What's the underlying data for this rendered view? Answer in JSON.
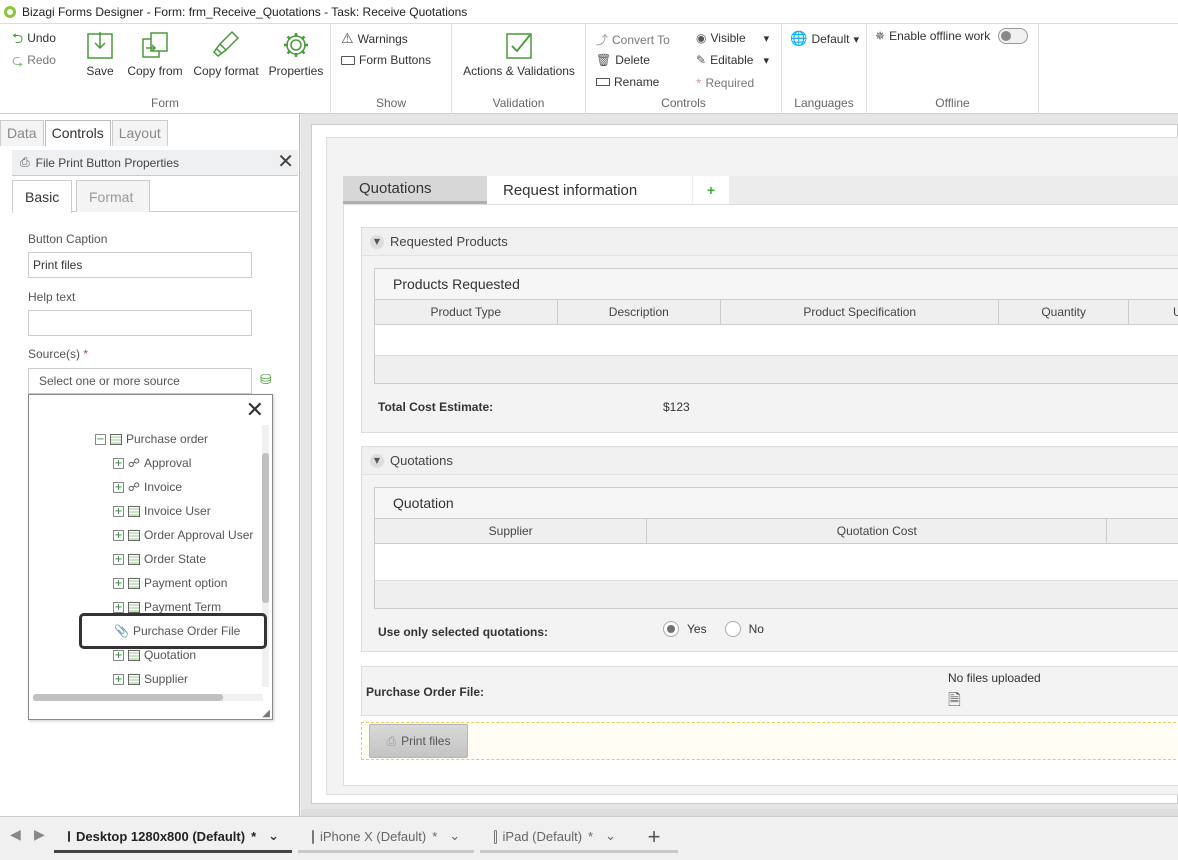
{
  "window": {
    "title": "Bizagi Forms Designer  -  Form: frm_Receive_Quotations - Task:  Receive Quotations"
  },
  "ribbon": {
    "form": {
      "label": "Form",
      "undo": "Undo",
      "redo": "Redo",
      "save": "Save",
      "copy_from": "Copy from",
      "copy_format": "Copy format",
      "properties": "Properties"
    },
    "show": {
      "label": "Show",
      "warnings": "Warnings",
      "form_buttons": "Form Buttons"
    },
    "validation": {
      "label": "Validation",
      "actions": "Actions & Validations"
    },
    "controls": {
      "label": "Controls",
      "convert_to": "Convert To",
      "delete": "Delete",
      "rename": "Rename",
      "visible": "Visible",
      "editable": "Editable",
      "required": "Required"
    },
    "languages": {
      "label": "Languages",
      "default": "Default"
    },
    "offline": {
      "label": "Offline",
      "enable": "Enable offline work"
    }
  },
  "left_panel": {
    "tabs": [
      "Data",
      "Controls",
      "Layout"
    ],
    "properties_title": "File Print Button Properties",
    "subtabs": [
      "Basic",
      "Format"
    ],
    "fields": {
      "caption_label": "Button Caption",
      "caption_value": "Print files",
      "help_label": "Help text",
      "help_value": "",
      "sources_label": "Source(s)",
      "sources_required": "*",
      "sources_placeholder": "Select one or more source"
    },
    "tree": {
      "root": "Purchase order",
      "items": [
        "Approval",
        "Invoice",
        "Invoice User",
        "Order Approval User",
        "Order State",
        "Payment option",
        "Payment Term",
        "Purchase Order File",
        "Quotation",
        "Supplier"
      ]
    }
  },
  "form": {
    "tabs": [
      "Quotations",
      "Request information"
    ],
    "add_tab": "+",
    "requested_products": {
      "title": "Requested Products",
      "grid_title": "Products Requested",
      "columns": [
        "Product Type",
        "Description",
        "Product Specification",
        "Quantity",
        "U"
      ],
      "total_label": "Total Cost Estimate:",
      "total_value": "$123"
    },
    "quotations": {
      "title": "Quotations",
      "grid_title": "Quotation",
      "columns": [
        "Supplier",
        "Quotation Cost",
        ""
      ],
      "use_selected_label": "Use only selected quotations:",
      "yes": "Yes",
      "no": "No"
    },
    "purchase_order_file": {
      "label": "Purchase Order File:",
      "status": "No files uploaded"
    },
    "print_button": "Print files"
  },
  "devices": [
    {
      "label": "Desktop 1280x800 (Default)",
      "modified": "*"
    },
    {
      "label": "iPhone X (Default)",
      "modified": "*"
    },
    {
      "label": "iPad (Default)",
      "modified": "*"
    }
  ]
}
